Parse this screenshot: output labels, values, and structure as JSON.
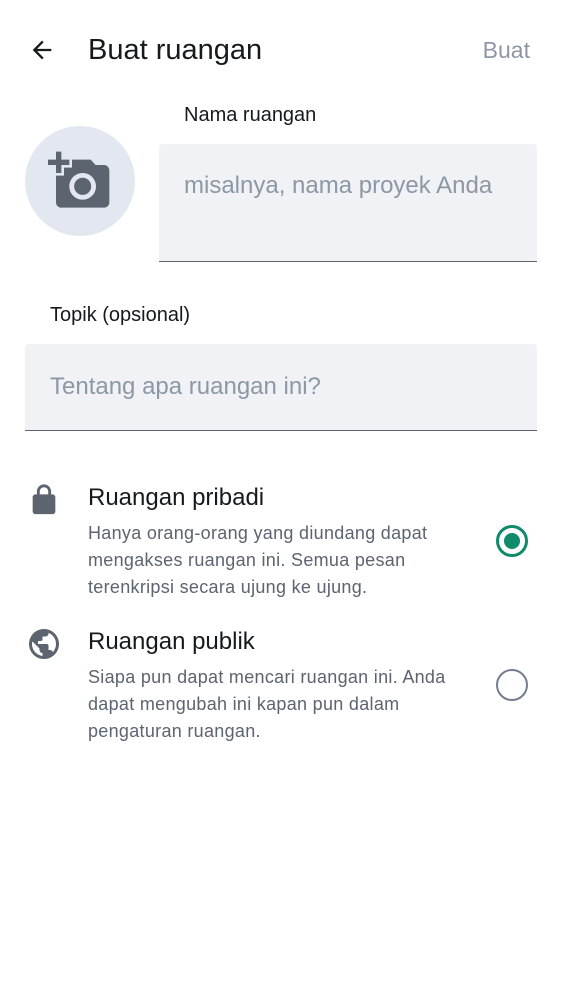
{
  "header": {
    "title": "Buat ruangan",
    "create_label": "Buat"
  },
  "avatar": {
    "icon": "add-photo-icon"
  },
  "name_field": {
    "label": "Nama ruangan",
    "placeholder": "misalnya, nama proyek Anda",
    "value": ""
  },
  "topic_field": {
    "label": "Topik (opsional)",
    "placeholder": "Tentang apa ruangan ini?",
    "value": ""
  },
  "room_types": [
    {
      "title": "Ruangan pribadi",
      "description": "Hanya orang-orang yang diundang dapat mengakses ruangan ini. Semua pesan terenkripsi secara ujung ke ujung.",
      "icon": "lock-icon",
      "selected": true
    },
    {
      "title": "Ruangan publik",
      "description": "Siapa pun dapat mencari ruangan ini. Anda dapat mengubah ini kapan pun dalam pengaturan ruangan.",
      "icon": "globe-icon",
      "selected": false
    }
  ],
  "colors": {
    "accent": "#0f8a6b",
    "placeholder": "#8d97a5",
    "field_bg": "#f0f2f5",
    "avatar_bg": "#e3e8f0"
  }
}
